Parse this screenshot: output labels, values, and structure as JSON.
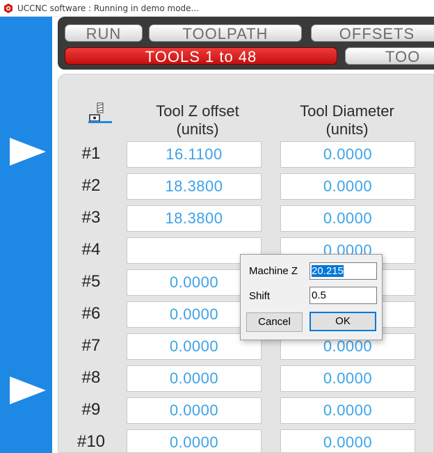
{
  "window": {
    "title": "UCCNC software : Running in demo mode..."
  },
  "tabs": {
    "row1": [
      "RUN",
      "TOOLPATH",
      "OFFSETS"
    ],
    "row2": [
      "TOOLS  1 to 48",
      "TOO"
    ]
  },
  "table": {
    "headers": {
      "z_offset": [
        "Tool Z offset",
        "(units)"
      ],
      "diameter": [
        "Tool Diameter",
        "(units)"
      ]
    },
    "rows": [
      {
        "label": "#1",
        "z": "16.1100",
        "d": "0.0000"
      },
      {
        "label": "#2",
        "z": "18.3800",
        "d": "0.0000"
      },
      {
        "label": "#3",
        "z": "18.3800",
        "d": "0.0000"
      },
      {
        "label": "#4",
        "z": "",
        "d": "0.0000"
      },
      {
        "label": "#5",
        "z": "0.0000",
        "d": ""
      },
      {
        "label": "#6",
        "z": "0.0000",
        "d": ""
      },
      {
        "label": "#7",
        "z": "0.0000",
        "d": "0.0000"
      },
      {
        "label": "#8",
        "z": "0.0000",
        "d": "0.0000"
      },
      {
        "label": "#9",
        "z": "0.0000",
        "d": "0.0000"
      },
      {
        "label": "#10",
        "z": "0.0000",
        "d": "0.0000"
      }
    ]
  },
  "dialog": {
    "machine_z_label": "Machine Z",
    "machine_z_value": "20.215",
    "shift_label": "Shift",
    "shift_value": "0.5",
    "cancel_label": "Cancel",
    "ok_label": "OK"
  },
  "colors": {
    "left_strip": "#1e88e5",
    "active_tab": "#e02020",
    "cell_text": "#3ea3e8",
    "tabbar_bg": "#3a3a3a"
  },
  "icons": {
    "app": "uccnc-logo-icon",
    "tool": "tool-length-probe-icon",
    "arrow": "play-arrow-icon"
  }
}
